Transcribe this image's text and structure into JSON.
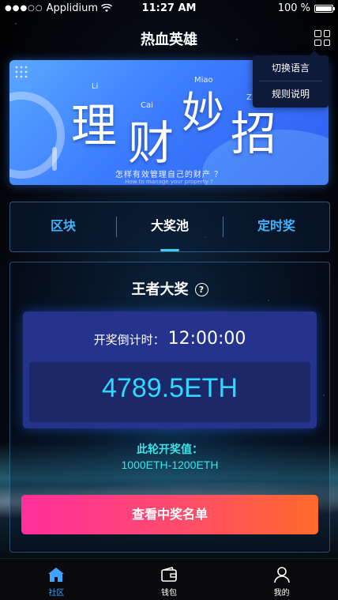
{
  "status_bar": {
    "carrier": "Applidium",
    "time": "11:27 AM",
    "battery": "100 %",
    "battery_level": 1.0
  },
  "header": {
    "title": "热血英雄"
  },
  "menu": {
    "items": [
      "切换语言",
      "规则说明"
    ]
  },
  "banner": {
    "chars": [
      "理",
      "财",
      "妙",
      "招"
    ],
    "pinyin": [
      "Li",
      "Cai",
      "Miao",
      "Z"
    ],
    "subtitle": "怎样有效管理自己的财产 ？",
    "subtitle_en": "How to manage your property ?"
  },
  "tabs": [
    {
      "label": "区块",
      "active": false
    },
    {
      "label": "大奖池",
      "active": true
    },
    {
      "label": "定时奖",
      "active": false
    }
  ],
  "prize": {
    "title": "王者大奖",
    "help_symbol": "?",
    "countdown_label": "开奖倒计时：",
    "countdown_value": "12:00:00",
    "amount": "4789.5ETH",
    "range_label": "此轮开奖值：",
    "range_value": "1000ETH-1200ETH",
    "button_label": "查看中奖名单"
  },
  "tabbar": [
    {
      "label": "社区",
      "icon": "home-icon",
      "active": true
    },
    {
      "label": "钱包",
      "icon": "wallet-icon",
      "active": false
    },
    {
      "label": "我的",
      "icon": "user-icon",
      "active": false
    }
  ],
  "colors": {
    "accent_blue": "#40b4ff",
    "prize_cyan": "#2ed8ff",
    "cta_start": "#ff2f9c",
    "cta_end": "#ff6a2a"
  }
}
